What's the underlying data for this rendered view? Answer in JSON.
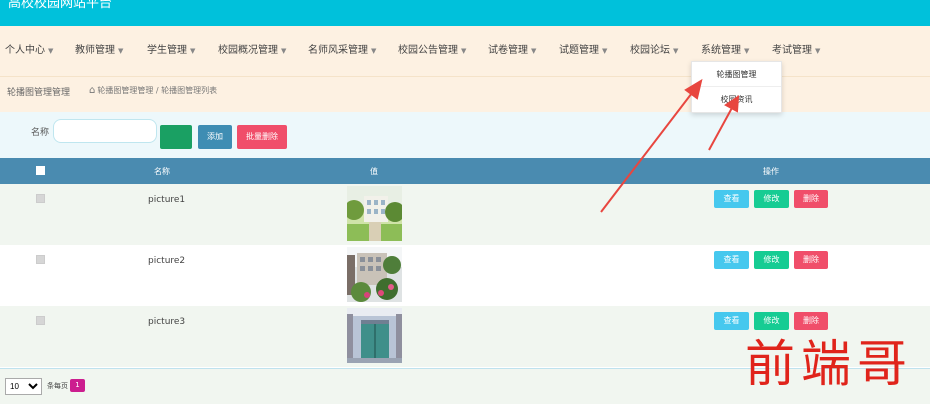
{
  "app": {
    "title": "高校校园网站平台"
  },
  "nav": {
    "items": [
      {
        "label": "个人中心"
      },
      {
        "label": "教师管理"
      },
      {
        "label": "学生管理"
      },
      {
        "label": "校园概况管理"
      },
      {
        "label": "名师风采管理"
      },
      {
        "label": "校园公告管理"
      },
      {
        "label": "试卷管理"
      },
      {
        "label": "试题管理"
      },
      {
        "label": "校园论坛"
      },
      {
        "label": "系统管理"
      },
      {
        "label": "考试管理"
      }
    ]
  },
  "dropdown": {
    "items": [
      {
        "label": "轮播图管理"
      },
      {
        "label": "校园资讯"
      }
    ]
  },
  "breadcrumb": {
    "page_title": "轮播图管理管理",
    "path": "轮播图管理管理 / 轮播图管理列表"
  },
  "search": {
    "label": "名称",
    "placeholder": "",
    "value": "",
    "search_button": "",
    "add_button": "添加",
    "batch_delete_button": "批量删除"
  },
  "table": {
    "columns": [
      "名称",
      "值",
      "操作"
    ],
    "rows": [
      {
        "name": "picture1"
      },
      {
        "name": "picture2"
      },
      {
        "name": "picture3"
      }
    ],
    "actions": {
      "view": "查看",
      "edit": "修改",
      "delete": "删除"
    }
  },
  "pagination": {
    "page_size": "10",
    "page_size_label": "条每页",
    "current_page": "1"
  },
  "watermark": "前端哥",
  "colors": {
    "topbar": "#00c1db",
    "nav_bg": "#fdf1e2",
    "table_header": "#4a8bb0",
    "view_button": "#46c8ee",
    "edit_button": "#16cc93",
    "delete_button": "#f04e6a",
    "annotation_arrow": "#e8463f"
  }
}
